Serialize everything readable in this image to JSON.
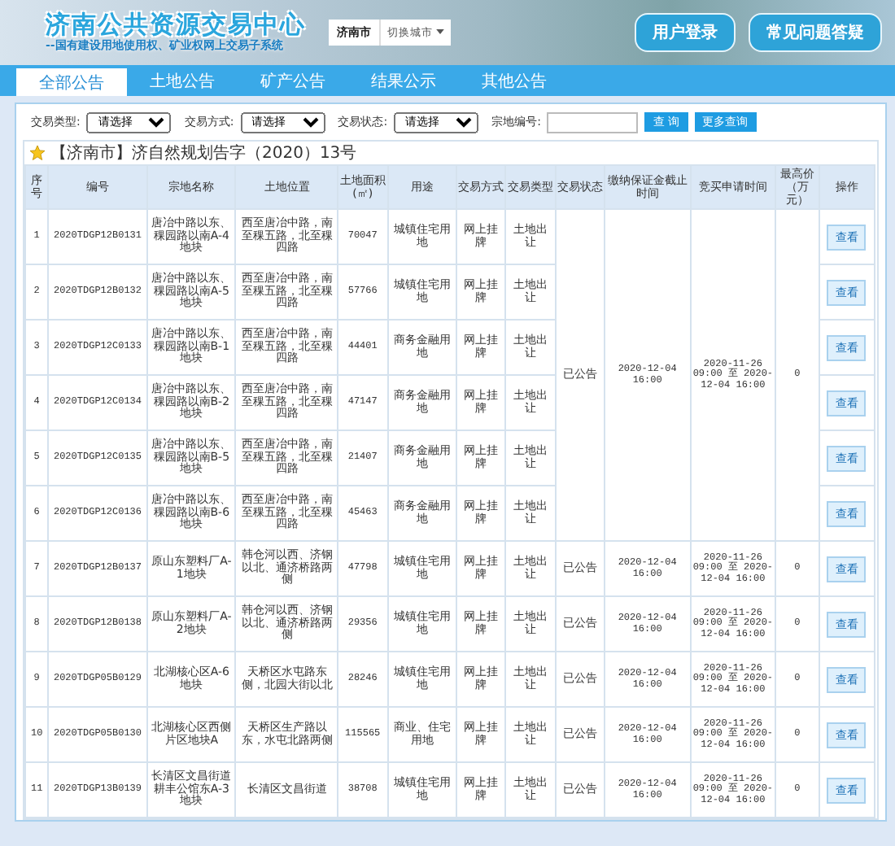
{
  "header": {
    "title": "济南公共资源交易中心",
    "subtitle": "--国有建设用地使用权、矿业权网上交易子系统",
    "city": "济南市",
    "city_switch": "切换城市",
    "buttons": [
      "用户登录",
      "常见问题答疑"
    ]
  },
  "tabs": [
    {
      "label": "全部公告",
      "selected": true
    },
    {
      "label": "土地公告",
      "selected": false
    },
    {
      "label": "矿产公告",
      "selected": false
    },
    {
      "label": "结果公示",
      "selected": false
    },
    {
      "label": "其他公告",
      "selected": false
    }
  ],
  "filters": {
    "selects": [
      {
        "label": "交易类型:",
        "value": "请选择"
      },
      {
        "label": "交易方式:",
        "value": "请选择"
      },
      {
        "label": "交易状态:",
        "value": "请选择"
      }
    ],
    "code_label": "宗地编号:",
    "search_button": "查 询",
    "more_button": "更多查询"
  },
  "announcement": {
    "title": "【济南市】济自然规划告字（2020）13号",
    "columns": [
      "序号",
      "编号",
      "宗地名称",
      "土地位置",
      "土地面积(㎡)",
      "用途",
      "交易方式",
      "交易类型",
      "交易状态",
      "缴纳保证金截止时间",
      "竞买申请时间",
      "最高价（万元）",
      "操作"
    ],
    "groups": [
      {
        "status": "已公告",
        "deadline": "2020-12-04 16:00",
        "apply_time": "2020-11-26 09:00 至 2020-12-04 16:00",
        "max_price": "0",
        "rows": [
          {
            "no": "1",
            "code": "2020TDGP12B0131",
            "name": "唐冶中路以东、稞园路以南A-4地块",
            "location": "西至唐冶中路，南至稞五路，北至稞四路",
            "area": "70047",
            "use": "城镇住宅用地",
            "method": "网上挂牌",
            "type": "土地出让",
            "action": "查看"
          },
          {
            "no": "2",
            "code": "2020TDGP12B0132",
            "name": "唐冶中路以东、稞园路以南A-5地块",
            "location": "西至唐冶中路，南至稞五路，北至稞四路",
            "area": "57766",
            "use": "城镇住宅用地",
            "method": "网上挂牌",
            "type": "土地出让",
            "action": "查看"
          },
          {
            "no": "3",
            "code": "2020TDGP12C0133",
            "name": "唐冶中路以东、稞园路以南B-1地块",
            "location": "西至唐冶中路，南至稞五路，北至稞四路",
            "area": "44401",
            "use": "商务金融用地",
            "method": "网上挂牌",
            "type": "土地出让",
            "action": "查看"
          },
          {
            "no": "4",
            "code": "2020TDGP12C0134",
            "name": "唐冶中路以东、稞园路以南B-2地块",
            "location": "西至唐冶中路，南至稞五路，北至稞四路",
            "area": "47147",
            "use": "商务金融用地",
            "method": "网上挂牌",
            "type": "土地出让",
            "action": "查看"
          },
          {
            "no": "5",
            "code": "2020TDGP12C0135",
            "name": "唐冶中路以东、稞园路以南B-5地块",
            "location": "西至唐冶中路，南至稞五路，北至稞四路",
            "area": "21407",
            "use": "商务金融用地",
            "method": "网上挂牌",
            "type": "土地出让",
            "action": "查看"
          },
          {
            "no": "6",
            "code": "2020TDGP12C0136",
            "name": "唐冶中路以东、稞园路以南B-6地块",
            "location": "西至唐冶中路，南至稞五路，北至稞四路",
            "area": "45463",
            "use": "商务金融用地",
            "method": "网上挂牌",
            "type": "土地出让",
            "action": "查看"
          }
        ]
      },
      {
        "status": "已公告",
        "deadline": "2020-12-04 16:00",
        "apply_time": "2020-11-26 09:00 至 2020-12-04 16:00",
        "max_price": "0",
        "rows": [
          {
            "no": "7",
            "code": "2020TDGP12B0137",
            "name": "原山东塑料厂A-1地块",
            "location": "韩仓河以西、济钢以北、通济桥路两侧",
            "area": "47798",
            "use": "城镇住宅用地",
            "method": "网上挂牌",
            "type": "土地出让",
            "action": "查看"
          }
        ]
      },
      {
        "status": "已公告",
        "deadline": "2020-12-04 16:00",
        "apply_time": "2020-11-26 09:00 至 2020-12-04 16:00",
        "max_price": "0",
        "rows": [
          {
            "no": "8",
            "code": "2020TDGP12B0138",
            "name": "原山东塑料厂A-2地块",
            "location": "韩仓河以西、济钢以北、通济桥路两侧",
            "area": "29356",
            "use": "城镇住宅用地",
            "method": "网上挂牌",
            "type": "土地出让",
            "action": "查看"
          }
        ]
      },
      {
        "status": "已公告",
        "deadline": "2020-12-04 16:00",
        "apply_time": "2020-11-26 09:00 至 2020-12-04 16:00",
        "max_price": "0",
        "rows": [
          {
            "no": "9",
            "code": "2020TDGP05B0129",
            "name": "北湖核心区A-6地块",
            "location": "天桥区水屯路东侧，北园大街以北",
            "area": "28246",
            "use": "城镇住宅用地",
            "method": "网上挂牌",
            "type": "土地出让",
            "action": "查看"
          }
        ]
      },
      {
        "status": "已公告",
        "deadline": "2020-12-04 16:00",
        "apply_time": "2020-11-26 09:00 至 2020-12-04 16:00",
        "max_price": "0",
        "rows": [
          {
            "no": "10",
            "code": "2020TDGP05B0130",
            "name": "北湖核心区西侧片区地块A",
            "location": "天桥区生产路以东，水屯北路两侧",
            "area": "115565",
            "use": "商业、住宅用地",
            "method": "网上挂牌",
            "type": "土地出让",
            "action": "查看"
          }
        ]
      },
      {
        "status": "已公告",
        "deadline": "2020-12-04 16:00",
        "apply_time": "2020-11-26 09:00 至 2020-12-04 16:00",
        "max_price": "0",
        "rows": [
          {
            "no": "11",
            "code": "2020TDGP13B0139",
            "name": "长清区文昌街道耕丰公馆东A-3地块",
            "location": "长清区文昌街道",
            "area": "38708",
            "use": "城镇住宅用地",
            "method": "网上挂牌",
            "type": "土地出让",
            "action": "查看"
          }
        ]
      }
    ]
  }
}
